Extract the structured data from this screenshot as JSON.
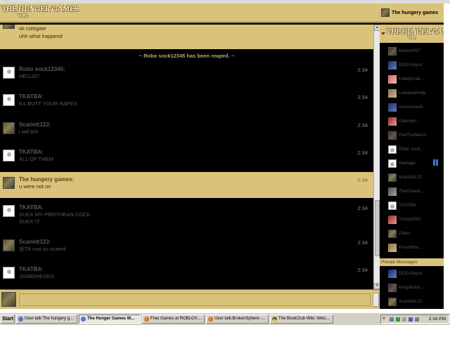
{
  "browser": {
    "url_fragment": "..."
  },
  "app": {
    "logo_line1": "THE HUNGER GAMES",
    "logo_line2": "WIKI",
    "current_user": "The hungery games"
  },
  "chat": {
    "top_partial_lines": [
      "ok colegate",
      "uhh what happend"
    ],
    "notice": "~ Robo sock12345 has been reaped. ~",
    "messages": [
      {
        "name": "Robo sock12345:",
        "lines": [
          "HELLO?"
        ],
        "time": "2:34",
        "avatar": "white",
        "highlight": false
      },
      {
        "name": "TKATBA:",
        "lines": [
          "ILL BUTT YOUR RAPES"
        ],
        "time": "2:34",
        "avatar": "white",
        "highlight": false
      },
      {
        "name": "Scarlett123:",
        "lines": [
          "i will brb"
        ],
        "time": "2:34",
        "avatar": "photo",
        "highlight": false
      },
      {
        "name": "TKATBA:",
        "lines": [
          "ALL OF THEM"
        ],
        "time": "2:34",
        "avatar": "white",
        "highlight": false
      },
      {
        "name": "The hungery games:",
        "lines": [
          "u were not on"
        ],
        "time": "2:34",
        "avatar": "photo",
        "highlight": true
      },
      {
        "name": "TKATBA:",
        "lines": [
          "SUCK MY PROTHEAN COCK",
          "SUCK IT"
        ],
        "time": "2:34",
        "avatar": "white",
        "highlight": false
      },
      {
        "name": "Scarlett123:",
        "lines": [
          "@TK ooo so scared"
        ],
        "time": "2:34",
        "avatar": "photo",
        "highlight": false
      },
      {
        "name": "TKATBA:",
        "lines": [
          "JSABDHKSKG"
        ],
        "time": "2:34",
        "avatar": "white",
        "highlight": false
      }
    ],
    "input_value": ""
  },
  "sidebar": {
    "users": [
      {
        "name": "Kellam097",
        "avatar": "dark"
      },
      {
        "name": "DOD Abyss",
        "avatar": "blue"
      },
      {
        "name": "Katelyn.da...",
        "avatar": "pink"
      },
      {
        "name": "LeelandAndy",
        "avatar": "tan"
      },
      {
        "name": "Uxxxxxxxx8",
        "avatar": "blue"
      },
      {
        "name": "Gaemyo...",
        "avatar": "red"
      },
      {
        "name": "RedTurtle410",
        "avatar": "dark"
      },
      {
        "name": "Robo sock...",
        "avatar": "white"
      },
      {
        "name": "Sactage",
        "avatar": "white",
        "bars": 2
      },
      {
        "name": "Scarlett123",
        "avatar": "photo"
      },
      {
        "name": "TheGreate...",
        "avatar": "grey"
      },
      {
        "name": "TKATBA",
        "avatar": "white"
      },
      {
        "name": "Trinity2000",
        "avatar": "red"
      },
      {
        "name": "Zakei",
        "avatar": "photo"
      },
      {
        "name": "Poundthe...",
        "avatar": "tan"
      }
    ],
    "private_messages_label": "Private Messages",
    "private_users": [
      {
        "name": "DOD Abyss",
        "avatar": "blue"
      },
      {
        "name": "Kingofclub...",
        "avatar": "dark"
      },
      {
        "name": "Scarlett123",
        "avatar": "photo"
      }
    ]
  },
  "taskbar": {
    "start_label": "Start",
    "tasks": [
      {
        "label": "User talk:The hungery g...",
        "icon": "ie",
        "active": false
      },
      {
        "label": "The Hunger Games W...",
        "icon": "ie",
        "active": true
      },
      {
        "label": "Free Games at ROBLOX....",
        "icon": "firefox",
        "active": false
      },
      {
        "label": "User talk:BrokenSphere -...",
        "icon": "firefox",
        "active": false
      },
      {
        "label": "The BookClub Wiki: Welc...",
        "icon": "chrome",
        "active": false
      }
    ],
    "tray_chevron": "«",
    "clock": "2:34 PM"
  }
}
